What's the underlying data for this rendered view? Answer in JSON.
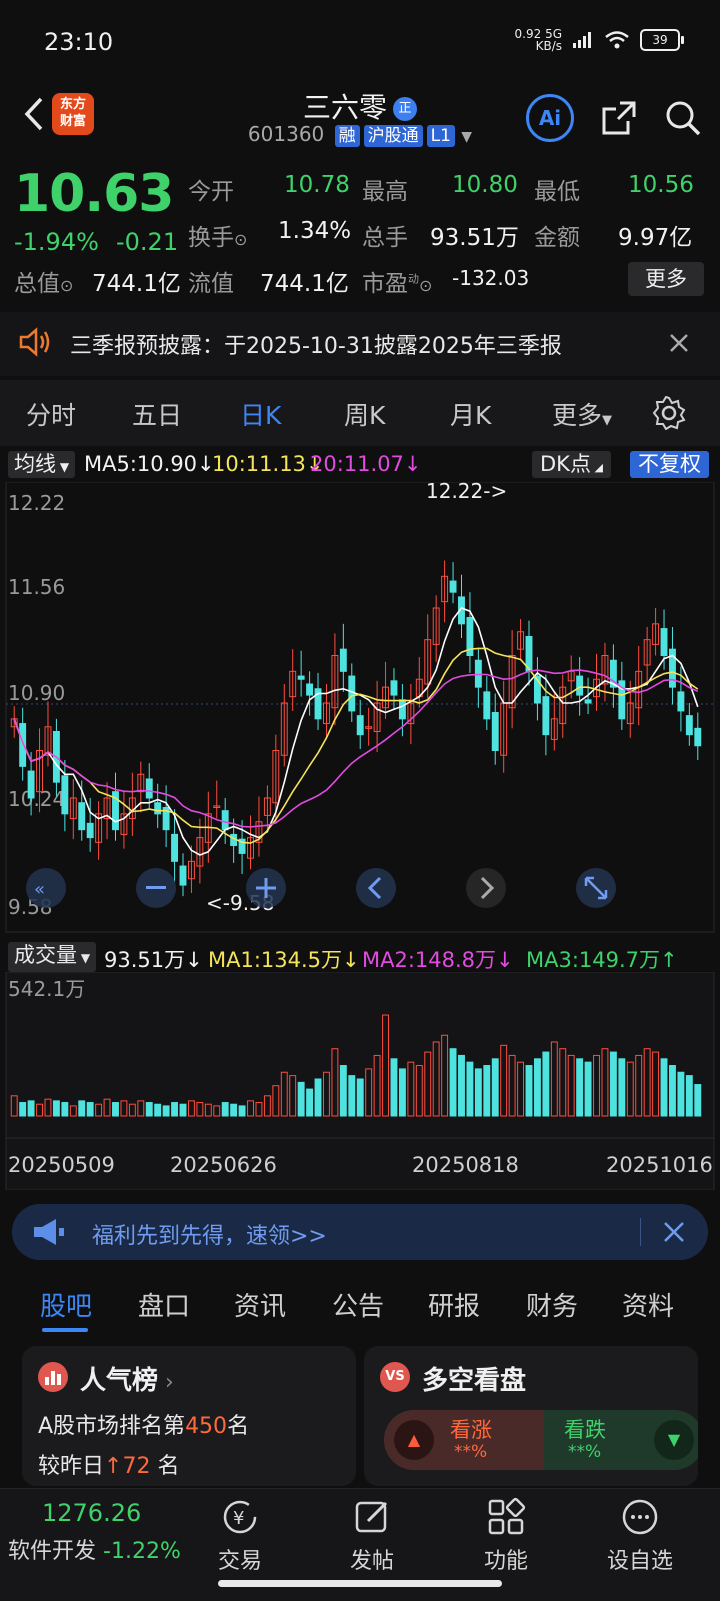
{
  "status_bar": {
    "time": "23:10",
    "net_speed": "0.92",
    "net_unit": "KB/s",
    "network": "5G",
    "battery": "39"
  },
  "header": {
    "logo_line1": "东方",
    "logo_line2": "财富",
    "stock_name": "三六零",
    "name_badge": "正",
    "code": "601360",
    "tags": [
      "融",
      "沪股通",
      "L1"
    ],
    "ai_label": "Ai"
  },
  "quote": {
    "price": "10.63",
    "change_pct": "-1.94%",
    "change": "-0.21",
    "open_label": "今开",
    "open": "10.78",
    "high_label": "最高",
    "high": "10.80",
    "low_label": "最低",
    "low": "10.56",
    "turnover_label": "换手",
    "turnover": "1.34%",
    "volume_label": "总手",
    "volume": "93.51万",
    "amount_label": "金额",
    "amount": "9.97亿",
    "mktcap_label": "总值",
    "mktcap": "744.1亿",
    "float_label": "流值",
    "float_cap": "744.1亿",
    "pe_label": "市盈",
    "pe_sup": "动",
    "pe": "-132.03",
    "more": "更多",
    "colors": {
      "up": "#ff4d3d",
      "down": "#3fd26b"
    }
  },
  "notice": {
    "text": "三季报预披露：于2025-10-31披露2025年三季报"
  },
  "period_tabs": [
    "分时",
    "五日",
    "日K",
    "周K",
    "月K",
    "更多"
  ],
  "period_active": 2,
  "ma_row": {
    "selector": "均线",
    "ma5": "MA5:10.90",
    "ma10": "10:11.13",
    "ma20": "20:11.07",
    "dk": "DK点",
    "fq": "不复权"
  },
  "kline_axis": {
    "top": "12.22",
    "mid1": "11.56",
    "mid2": "10.90",
    "mid3": "10.24",
    "bottom": "9.58"
  },
  "kline_labels": {
    "high_note": "12.22->",
    "low_note": "<-9.58"
  },
  "volume_row": {
    "selector": "成交量",
    "vol": "93.51万",
    "ma1": "MA1:134.5万",
    "ma2": "MA2:148.8万",
    "ma3": "MA3:149.7万",
    "max": "542.1万"
  },
  "x_dates": [
    "20250509",
    "20250626",
    "20250818",
    "20251016"
  ],
  "chart_data": {
    "type": "candlestick",
    "ylim": [
      9.58,
      12.22
    ],
    "closes": [
      10.8,
      10.5,
      10.3,
      10.6,
      10.75,
      10.4,
      10.2,
      10.3,
      10.1,
      10.05,
      10.2,
      10.3,
      10.1,
      10.2,
      10.3,
      10.45,
      10.3,
      10.2,
      10.1,
      9.9,
      9.75,
      9.9,
      10.05,
      10.2,
      10.25,
      10.1,
      10.0,
      9.95,
      10.05,
      10.15,
      10.3,
      10.6,
      10.9,
      11.1,
      11.05,
      10.95,
      10.8,
      10.9,
      11.2,
      11.1,
      10.85,
      10.7,
      10.75,
      10.9,
      11.0,
      10.95,
      10.8,
      10.9,
      11.05,
      11.3,
      11.5,
      11.7,
      11.6,
      11.4,
      11.2,
      11.0,
      10.8,
      10.6,
      10.9,
      11.2,
      11.35,
      11.1,
      10.9,
      10.7,
      10.8,
      11.0,
      11.1,
      10.95,
      10.9,
      11.05,
      11.2,
      11.0,
      10.8,
      10.9,
      11.1,
      11.3,
      11.4,
      11.2,
      11.0,
      10.85,
      10.7,
      10.63
    ],
    "x_ticks": [
      "20250509",
      "20250626",
      "20250818",
      "20251016"
    ],
    "annotations": [
      "12.22->",
      "<-9.58"
    ],
    "volume": {
      "ymax": 542.1,
      "values": [
        60,
        40,
        45,
        35,
        50,
        45,
        40,
        30,
        45,
        40,
        35,
        50,
        40,
        45,
        35,
        45,
        40,
        35,
        30,
        40,
        35,
        45,
        40,
        35,
        30,
        40,
        35,
        30,
        45,
        40,
        60,
        90,
        130,
        120,
        100,
        80,
        110,
        130,
        200,
        150,
        120,
        110,
        140,
        180,
        300,
        170,
        140,
        160,
        150,
        190,
        220,
        240,
        200,
        180,
        160,
        140,
        150,
        170,
        210,
        180,
        160,
        150,
        170,
        190,
        220,
        200,
        180,
        170,
        160,
        180,
        200,
        190,
        170,
        160,
        180,
        200,
        190,
        170,
        150,
        130,
        120,
        93.5
      ]
    }
  },
  "promo": {
    "text": "福利先到先得，速领>>"
  },
  "sub_tabs": [
    "股吧",
    "盘口",
    "资讯",
    "公告",
    "研报",
    "财务",
    "资料"
  ],
  "popularity": {
    "title": "人气榜",
    "rank_prefix": "A股市场排名第",
    "rank": "450",
    "rank_suffix": "名",
    "change_prefix": "较昨日",
    "change": "72",
    "change_suffix": "名"
  },
  "bullbear": {
    "title": "多空看盘",
    "bull": "看涨",
    "bear": "看跌",
    "bull_pct": "**%",
    "bear_pct": "**%"
  },
  "bottom_nav": {
    "index_value": "1276.26",
    "index_name": "软件开发",
    "index_change": "-1.22%",
    "items": [
      "交易",
      "发帖",
      "功能",
      "设自选"
    ]
  }
}
